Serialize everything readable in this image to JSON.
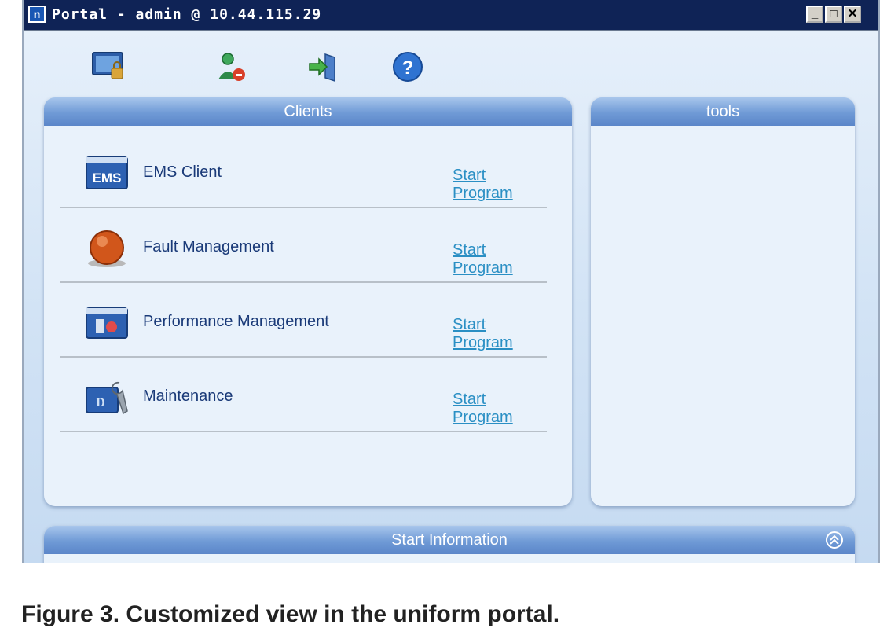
{
  "window": {
    "title": "Portal - admin @ 10.44.115.29",
    "app_icon": "portal-icon",
    "controls": [
      "minimize",
      "maximize",
      "close"
    ]
  },
  "toolbar": {
    "items": [
      {
        "icon": "lock-screen-icon"
      },
      {
        "icon": "user-logout-icon"
      },
      {
        "icon": "exit-door-icon"
      },
      {
        "icon": "help-icon",
        "glyph": "?"
      }
    ]
  },
  "clients_panel": {
    "title": "Clients",
    "items": [
      {
        "name": "EMS Client",
        "icon": "ems-icon",
        "icon_text": "EMS",
        "link": "Start Program"
      },
      {
        "name": "Fault Management",
        "icon": "fault-alarm-icon",
        "link": "Start Program"
      },
      {
        "name": "Performance Management",
        "icon": "performance-icon",
        "link": "Start Program"
      },
      {
        "name": "Maintenance",
        "icon": "maintenance-wrench-icon",
        "link": "Start Program"
      }
    ]
  },
  "tools_panel": {
    "title": "tools"
  },
  "start_info_panel": {
    "title": "Start Information",
    "collapse_icon": "collapse-up-icon"
  },
  "caption": "Figure 3. Customized view in the uniform portal.",
  "colors": {
    "titlebar": "#0f2356",
    "panel_header": "#6f9ad6",
    "link": "#2a8fc4",
    "client_text": "#1a3a78"
  }
}
